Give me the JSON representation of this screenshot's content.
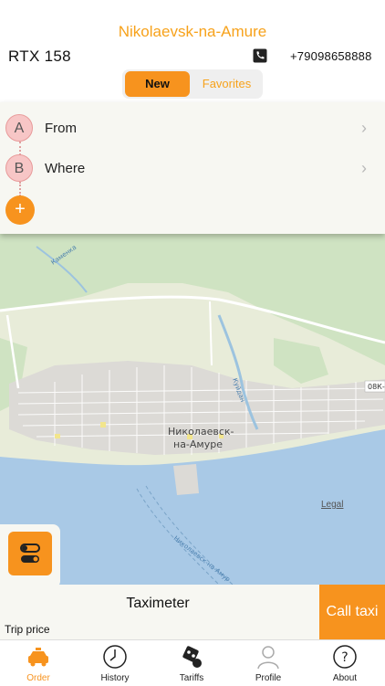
{
  "header": {
    "city": "Nikolaevsk-na-Amure",
    "company": "RTX 158",
    "phone_icon": "phone-icon",
    "phone": "+79098658888"
  },
  "order_mode": {
    "new_label": "New",
    "favorites_label": "Favorites",
    "selected": "New"
  },
  "route": {
    "from": {
      "marker": "A",
      "label": "From"
    },
    "where": {
      "marker": "B",
      "label": "Where"
    },
    "add_label": "+"
  },
  "map": {
    "city_label_line1": "Николаевск-",
    "city_label_line2": "на-Амуре",
    "river_label_1": "Куйдан",
    "river_label_2": "Каменка",
    "river_label_3": "Николаевск-на-Амур",
    "road_label": "08К-",
    "legal": "Legal"
  },
  "taximeter": {
    "title": "Taximeter",
    "trip_price_label": "Trip price"
  },
  "call_taxi": "Call taxi",
  "tabs": [
    {
      "label": "Order",
      "icon": "taxi-car-icon",
      "active": true
    },
    {
      "label": "History",
      "icon": "clock-icon",
      "active": false
    },
    {
      "label": "Tariffs",
      "icon": "tariffs-icon",
      "active": false
    },
    {
      "label": "Profile",
      "icon": "user-icon",
      "active": false
    },
    {
      "label": "About",
      "icon": "help-icon",
      "active": false
    }
  ],
  "colors": {
    "accent": "#f7931e",
    "city_title": "#f7a21b",
    "marker_fill": "#f7c6c6",
    "panel_bg": "#f7f7f2"
  }
}
